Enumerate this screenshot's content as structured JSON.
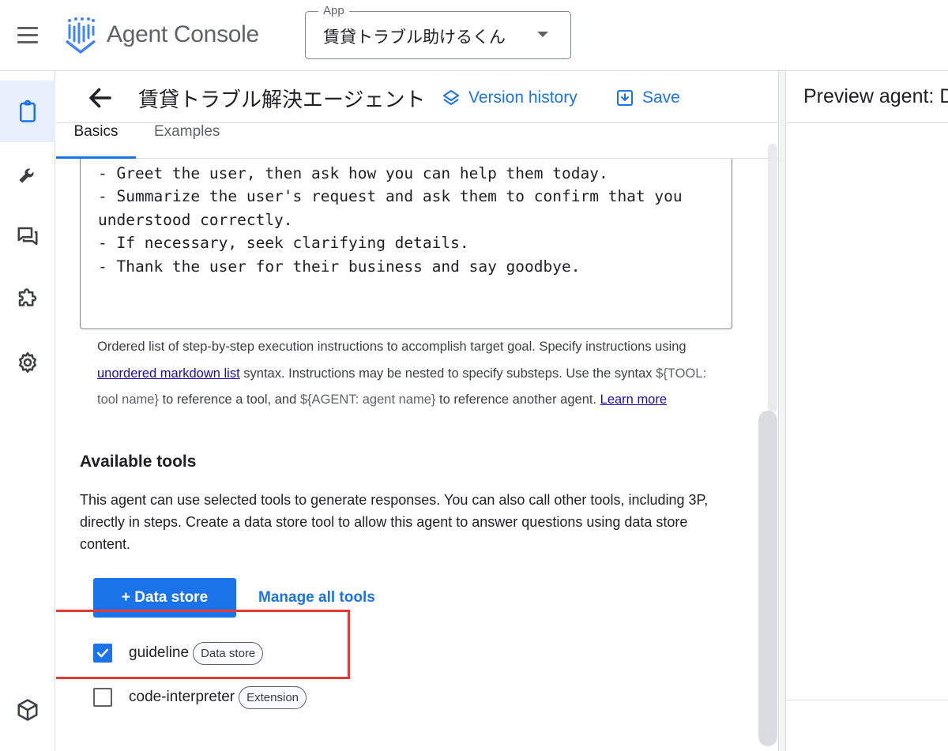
{
  "topbar": {
    "brand": "Agent Console",
    "app_label": "App",
    "app_value": "賃貸トラブル助けるくん"
  },
  "editor": {
    "title": "賃貸トラブル解決エージェント",
    "version_history": "Version history",
    "save": "Save"
  },
  "tabs": [
    {
      "label": "Basics",
      "active": true
    },
    {
      "label": "Examples",
      "active": false
    }
  ],
  "instructions": {
    "lines": [
      "- Greet the user, then ask how you can help them today.",
      "- Summarize the user's request and ask them to confirm that you",
      "understood correctly.",
      "- If necessary, seek clarifying details.",
      "- Thank the user for their business and say goodbye."
    ],
    "help_part1": "Ordered list of step-by-step execution instructions to accomplish target goal. Specify instructions using",
    "help_link1": "unordered markdown list",
    "help_part2": "syntax. Instructions may be nested to specify substeps. Use the syntax",
    "help_code1": "${TOOL: tool name}",
    "help_part3": "to reference a tool, and",
    "help_code2": "${AGENT: agent name}",
    "help_part4": "to reference another agent.",
    "help_link2": "Learn more"
  },
  "tools": {
    "heading": "Available tools",
    "description": "This agent can use selected tools to generate responses. You can also call other tools, including 3P, directly in steps. Create a data store tool to allow this agent to answer questions using data store content.",
    "add_button": "+ Data store",
    "manage_link": "Manage all tools",
    "items": [
      {
        "name": "guideline",
        "badge": "Data store",
        "checked": true
      },
      {
        "name": "code-interpreter",
        "badge": "Extension",
        "checked": false
      }
    ]
  },
  "preview": {
    "title": "Preview agent: D"
  },
  "colors": {
    "accent": "#1a73e8",
    "highlight": "#e53935",
    "rail_active": "#e8f0fe"
  },
  "icons": [
    "menu-icon",
    "agent-console-logo-icon",
    "chevron-down-icon",
    "clipboard-icon",
    "wrench-icon",
    "chat-icon",
    "puzzle-icon",
    "gear-icon",
    "cube-icon",
    "arrow-back-icon",
    "layers-icon",
    "save-icon",
    "checkmark-icon"
  ]
}
